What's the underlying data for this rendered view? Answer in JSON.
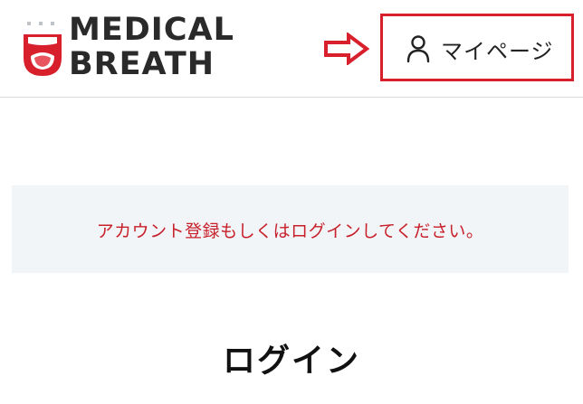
{
  "header": {
    "logo": {
      "line1": "MEDICAL",
      "line2": "BREATH",
      "icon": "open-mouth-logo"
    },
    "arrow_icon": "right-arrow-icon",
    "mypage": {
      "label": "マイページ",
      "icon": "user-icon"
    },
    "highlight_color": "#d8202c"
  },
  "notice": {
    "text": "アカウント登録もしくはログインしてください。",
    "text_color": "#c8202a",
    "background": "#f2f5f8"
  },
  "main": {
    "title": "ログイン"
  }
}
